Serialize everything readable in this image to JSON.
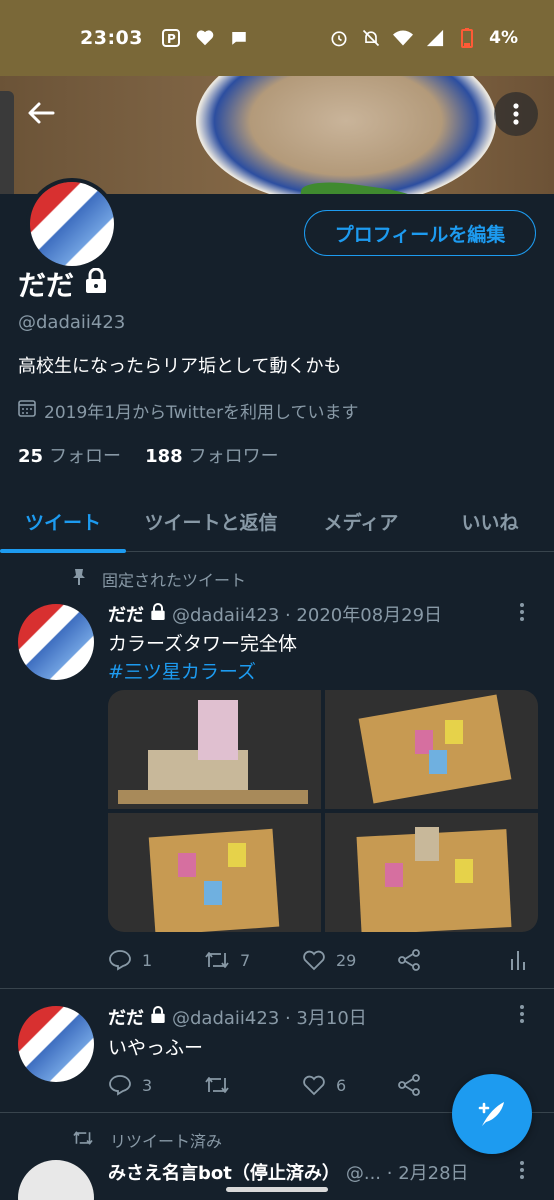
{
  "status_bar": {
    "time": "23:03",
    "battery": "4%"
  },
  "profile": {
    "edit_label": "プロフィールを編集",
    "name": "だだ",
    "handle": "@dadaii423",
    "bio": "高校生になったらリア垢として動くかも",
    "joined": "2019年1月からTwitterを利用しています",
    "following_count": "25",
    "following_label": "フォロー",
    "followers_count": "188",
    "followers_label": "フォロワー"
  },
  "tabs": [
    {
      "label": "ツイート"
    },
    {
      "label": "ツイートと返信"
    },
    {
      "label": "メディア"
    },
    {
      "label": "いいね"
    }
  ],
  "tweets": [
    {
      "context": "固定されたツイート",
      "name": "だだ",
      "meta": "@dadaii423 · 2020年08月29日",
      "text": "カラーズタワー完全体",
      "hashtag": "#三ツ星カラーズ",
      "replies": "1",
      "retweets": "7",
      "likes": "29"
    },
    {
      "name": "だだ",
      "meta": "@dadaii423 · 3月10日",
      "text": "いやっふー",
      "replies": "3",
      "retweets": "",
      "likes": "6"
    },
    {
      "context": "リツイート済み",
      "name": "みさえ名言bot（停止済み）",
      "meta": "@... · 2月28日"
    }
  ],
  "colors": {
    "accent": "#1d9bf0",
    "background": "#15202b",
    "muted": "#8899a6"
  }
}
